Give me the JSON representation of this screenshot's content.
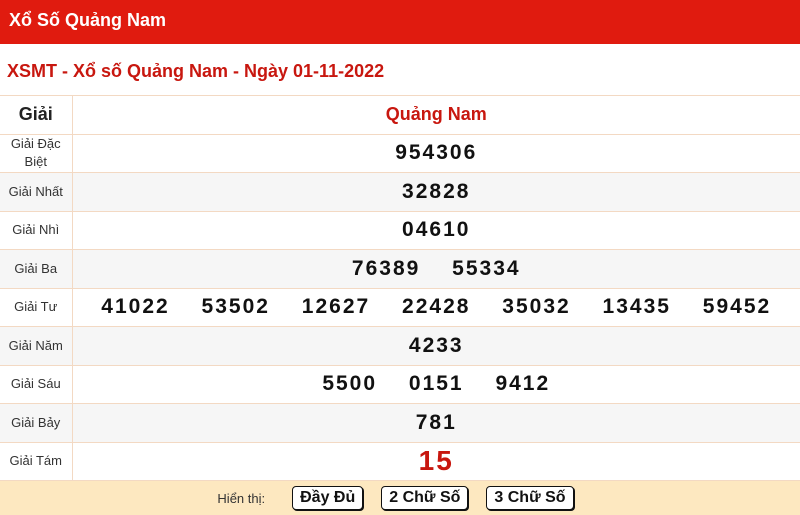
{
  "header": {
    "title": "Xổ Số Quảng Nam"
  },
  "subtitle": "XSMT - Xổ số Quảng Nam - Ngày 01-11-2022",
  "table": {
    "prize_col_header": "Giải",
    "province_header": "Quảng Nam",
    "rows": [
      {
        "name": "Giải Đặc Biệt",
        "numbers": [
          "954306"
        ]
      },
      {
        "name": "Giải Nhất",
        "numbers": [
          "32828"
        ]
      },
      {
        "name": "Giải Nhì",
        "numbers": [
          "04610"
        ]
      },
      {
        "name": "Giải Ba",
        "numbers": [
          "76389",
          "55334"
        ]
      },
      {
        "name": "Giải Tư",
        "numbers": [
          "41022",
          "53502",
          "12627",
          "22428",
          "35032",
          "13435",
          "59452"
        ]
      },
      {
        "name": "Giải Năm",
        "numbers": [
          "4233"
        ]
      },
      {
        "name": "Giải Sáu",
        "numbers": [
          "5500",
          "0151",
          "9412"
        ]
      },
      {
        "name": "Giải Bảy",
        "numbers": [
          "781"
        ]
      },
      {
        "name": "Giải Tám",
        "numbers": [
          "15"
        ]
      }
    ]
  },
  "footer": {
    "label": "Hiển thị:",
    "buttons": [
      "Đầy Đủ",
      "2 Chữ Số",
      "3 Chữ Số"
    ]
  },
  "colors": {
    "brand_red": "#e01b0f",
    "accent_red": "#c8170f",
    "footer_bg": "#fde8c0"
  }
}
